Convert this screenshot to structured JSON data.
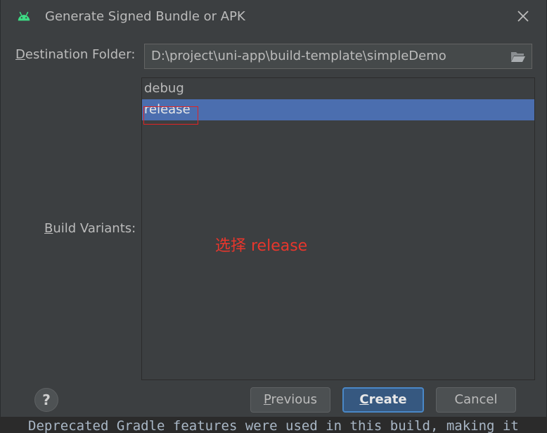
{
  "window": {
    "title": "Generate Signed Bundle or APK",
    "app_icon": "android-icon",
    "close_icon": "close-icon"
  },
  "destination": {
    "label": "Destination Folder:",
    "value": "D:\\project\\uni-app\\build-template\\simpleDemo",
    "browse_icon": "folder-icon"
  },
  "build_variants": {
    "label": "Build Variants:",
    "items": [
      {
        "label": "debug",
        "selected": false
      },
      {
        "label": "release",
        "selected": true
      }
    ]
  },
  "annotation": {
    "text": "选择 release",
    "color": "#e8362c"
  },
  "buttons": {
    "help": "?",
    "previous": "Previous",
    "create": "Create",
    "cancel": "Cancel"
  },
  "background_console": {
    "text": "Deprecated Gradle features were used in this build, making it"
  },
  "colors": {
    "dialog_bg": "#3c3f41",
    "selection": "#4b6eaf",
    "default_button_border": "#4a88c7",
    "android_green": "#3ddc84"
  }
}
